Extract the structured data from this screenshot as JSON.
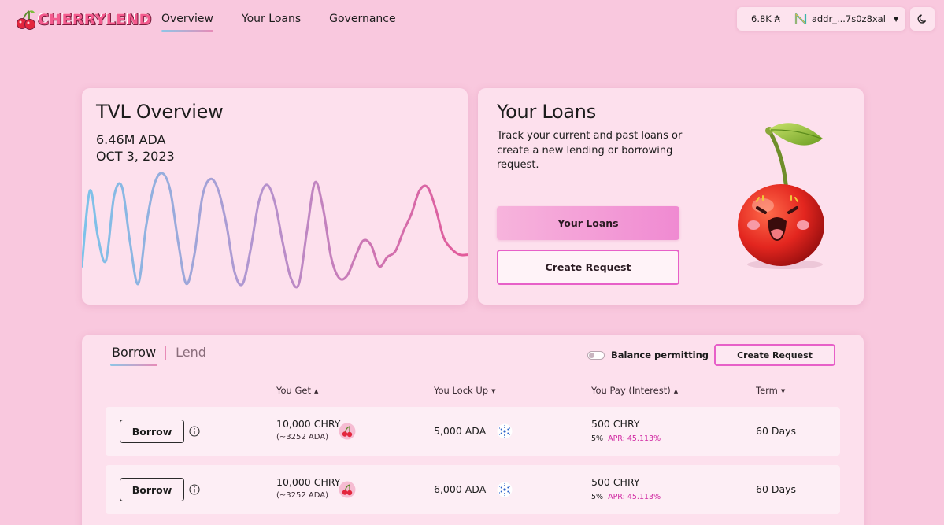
{
  "brand": {
    "name": "CHERRYLEND"
  },
  "nav": [
    {
      "label": "Overview",
      "active": true
    },
    {
      "label": "Your Loans",
      "active": false
    },
    {
      "label": "Governance",
      "active": false
    }
  ],
  "wallet": {
    "balance": "6.8K ₳",
    "address": "addr_...7s0z8xal"
  },
  "tvl": {
    "title": "TVL Overview",
    "value": "6.46M ADA",
    "date": "OCT 3, 2023"
  },
  "chart_data": {
    "type": "line",
    "title": "TVL Overview",
    "xlabel": "",
    "ylabel": "",
    "grid": false,
    "x": [
      0,
      1,
      2,
      3,
      4,
      5,
      6,
      7,
      8,
      9,
      10,
      11,
      12,
      13,
      14,
      15,
      16,
      17,
      18,
      19,
      20,
      21,
      22,
      23,
      24,
      25,
      26,
      27,
      28,
      29,
      30,
      31,
      32,
      33,
      34,
      35,
      36,
      37,
      38,
      39,
      40,
      41,
      42,
      43,
      44,
      45,
      46,
      47,
      48
    ],
    "values": [
      0.2,
      0.85,
      0.45,
      0.25,
      0.8,
      0.88,
      0.4,
      0.05,
      0.55,
      0.9,
      1.0,
      0.85,
      0.4,
      0.05,
      0.3,
      0.8,
      0.95,
      0.85,
      0.55,
      0.15,
      0.05,
      0.35,
      0.75,
      0.9,
      0.75,
      0.4,
      0.1,
      0.05,
      0.5,
      0.92,
      0.7,
      0.28,
      0.1,
      0.12,
      0.28,
      0.42,
      0.38,
      0.2,
      0.28,
      0.33,
      0.5,
      0.65,
      0.85,
      0.88,
      0.7,
      0.45,
      0.35,
      0.3,
      0.3
    ],
    "colors": [
      "#7cc3ea",
      "#b394cf",
      "#e35a9a"
    ]
  },
  "loans": {
    "title": "Your Loans",
    "description": "Track your current and past loans or create a new lending or borrowing request.",
    "primary_button": "Your Loans",
    "secondary_button": "Create Request"
  },
  "market": {
    "tabs": [
      {
        "label": "Borrow",
        "active": true
      },
      {
        "label": "Lend",
        "active": false
      }
    ],
    "toggle_label": "Balance permitting",
    "create_button": "Create Request",
    "columns": {
      "get": "You Get",
      "lock": "You Lock Up",
      "pay": "You Pay (Interest)",
      "term": "Term"
    },
    "rows": [
      {
        "action": "Borrow",
        "get_amount": "10,000 CHRY",
        "get_sub": "(~3252 ADA)",
        "lock_amount": "5,000 ADA",
        "pay_amount": "500 CHRY",
        "pay_pct": "5%",
        "pay_apr": "APR: 45.113%",
        "term": "60 Days"
      },
      {
        "action": "Borrow",
        "get_amount": "10,000 CHRY",
        "get_sub": "(~3252 ADA)",
        "lock_amount": "6,000 ADA",
        "pay_amount": "500 CHRY",
        "pay_pct": "5%",
        "pay_apr": "APR: 45.113%",
        "term": "60 Days"
      }
    ]
  },
  "colors": {
    "background": "#f9c8de",
    "card": "#fde0ed",
    "accent": "#e760c8",
    "apr": "#d12ba3"
  }
}
